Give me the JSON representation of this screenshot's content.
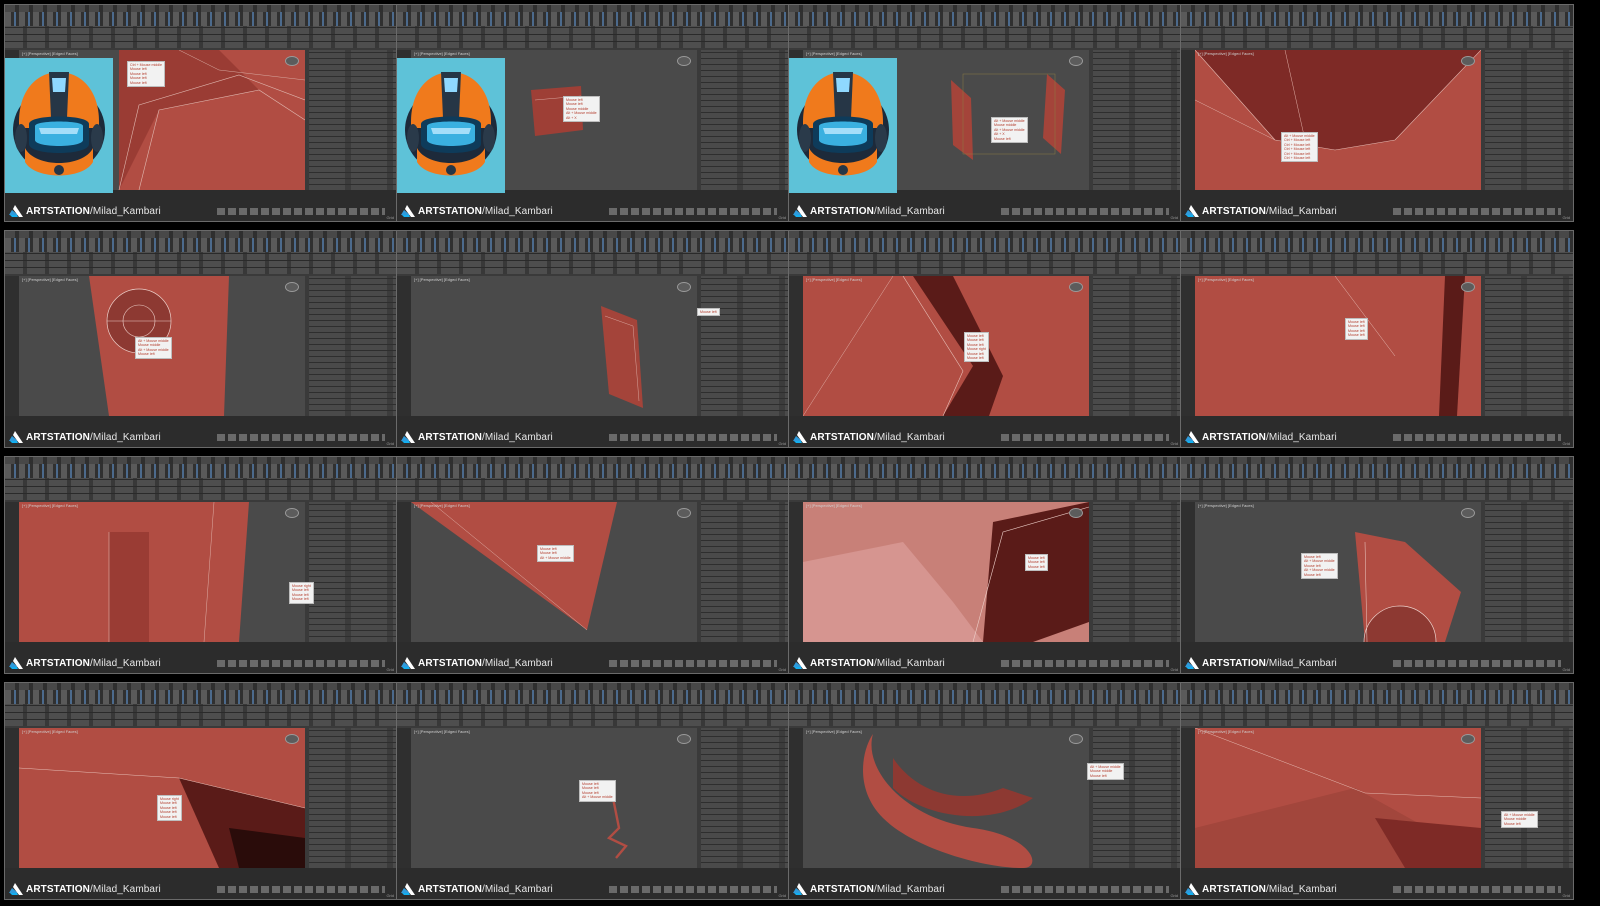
{
  "watermark": {
    "brand": "ARTSTATION",
    "handle": "/Milad_Kambari"
  },
  "app": {
    "viewport_label": "[+] [Perspective] [Edged Faces]",
    "status_corner": "Grid",
    "accent_color": "#b5473b"
  },
  "tiles": [
    {
      "id": 1,
      "has_reference_helmet": true,
      "keycast": [
        "Ctrl + Mouse middle",
        "Mouse left",
        "Mouse left",
        "Mouse left",
        "Mouse left"
      ]
    },
    {
      "id": 2,
      "has_reference_helmet": true,
      "keycast": [
        "Mouse left",
        "Mouse left",
        "Mouse middle",
        "Alt + Mouse middle",
        "Alt + X"
      ]
    },
    {
      "id": 3,
      "has_reference_helmet": true,
      "keycast": [
        "Alt + Mouse middle",
        "Mouse middle",
        "Alt + Mouse middle",
        "Alt + X",
        "Mouse left"
      ]
    },
    {
      "id": 4,
      "has_reference_helmet": false,
      "keycast": [
        "Alt + Mouse middle",
        "Ctrl + Mouse left",
        "Ctrl + Mouse left",
        "Ctrl + Mouse left",
        "Ctrl + Mouse left",
        "Ctrl + Mouse left"
      ]
    },
    {
      "id": 5,
      "has_reference_helmet": false,
      "keycast": [
        "Alt + Mouse middle",
        "Mouse middle",
        "Alt + Mouse middle",
        "Mouse left"
      ]
    },
    {
      "id": 6,
      "has_reference_helmet": false,
      "keycast": [
        "Mouse left"
      ]
    },
    {
      "id": 7,
      "has_reference_helmet": false,
      "keycast": [
        "Mouse left",
        "Mouse left",
        "Mouse left",
        "Mouse right",
        "Mouse left",
        "Mouse left"
      ]
    },
    {
      "id": 8,
      "has_reference_helmet": false,
      "keycast": [
        "Mouse left",
        "Mouse left",
        "Mouse left",
        "Mouse left"
      ]
    },
    {
      "id": 9,
      "has_reference_helmet": false,
      "keycast": [
        "Mouse right",
        "Mouse left",
        "Mouse left",
        "Mouse left"
      ]
    },
    {
      "id": 10,
      "has_reference_helmet": false,
      "keycast": [
        "Mouse left",
        "Mouse left",
        "Alt + Mouse middle"
      ]
    },
    {
      "id": 11,
      "has_reference_helmet": false,
      "keycast": [
        "Mouse left",
        "Mouse left",
        "Mouse left"
      ]
    },
    {
      "id": 12,
      "has_reference_helmet": false,
      "keycast": [
        "Mouse left",
        "Alt + Mouse middle",
        "Mouse left",
        "Alt + Mouse middle",
        "Mouse left"
      ]
    },
    {
      "id": 13,
      "has_reference_helmet": false,
      "keycast": [
        "Mouse right",
        "Mouse left",
        "Mouse left",
        "Mouse left",
        "Mouse left"
      ]
    },
    {
      "id": 14,
      "has_reference_helmet": false,
      "keycast": [
        "Mouse left",
        "Mouse left",
        "Mouse left",
        "Alt + Mouse middle"
      ]
    },
    {
      "id": 15,
      "has_reference_helmet": false,
      "keycast": [
        "Alt + Mouse middle",
        "Mouse middle",
        "Mouse left"
      ]
    },
    {
      "id": 16,
      "has_reference_helmet": false,
      "keycast": [
        "Alt + Mouse middle",
        "Mouse middle",
        "Mouse left"
      ]
    }
  ]
}
